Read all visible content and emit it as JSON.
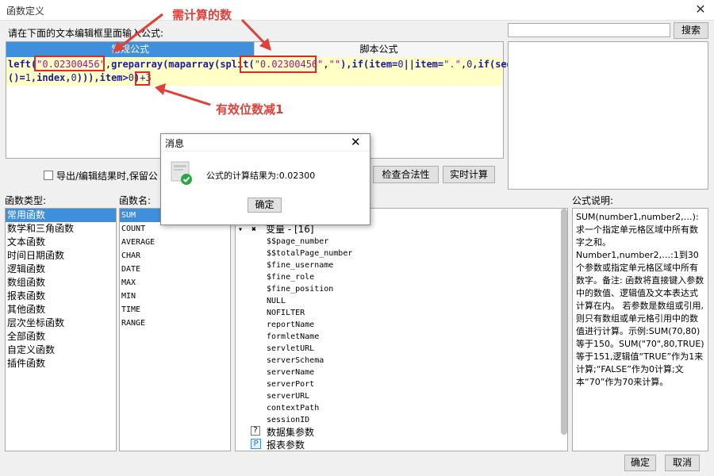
{
  "window": {
    "title": "函数定义"
  },
  "prompt": "请在下面的文本编辑框里面输入公式:",
  "search": {
    "placeholder": "",
    "button": "搜索"
  },
  "tabs": [
    {
      "label": "常规公式",
      "active": true
    },
    {
      "label": "脚本公式",
      "active": false
    }
  ],
  "code": {
    "line1": [
      {
        "t": "left(",
        "c": "kw"
      },
      {
        "t": "\"0.02300456\"",
        "c": "str"
      },
      {
        "t": ",",
        "c": ""
      },
      {
        "t": "greparray(maparray(split(",
        "c": "kw"
      },
      {
        "t": "\"0.02300456\"",
        "c": "str"
      },
      {
        "t": ",",
        "c": ""
      },
      {
        "t": "\"\"",
        "c": "str"
      },
      {
        "t": "),if(item=",
        "c": "kw"
      },
      {
        "t": "0",
        "c": "num"
      },
      {
        "t": "||item=",
        "c": "kw"
      },
      {
        "t": "\".\"",
        "c": "str"
      },
      {
        "t": ",",
        "c": ""
      },
      {
        "t": "0",
        "c": "num"
      },
      {
        "t": ",if(seq",
        "c": "kw"
      }
    ],
    "line2": [
      {
        "t": "()=",
        "c": "kw"
      },
      {
        "t": "1",
        "c": "num"
      },
      {
        "t": ",index,",
        "c": "kw"
      },
      {
        "t": "0",
        "c": "num"
      },
      {
        "t": "))),item>",
        "c": "kw"
      },
      {
        "t": "0",
        "c": "num"
      },
      {
        "t": ")",
        "c": "kw"
      },
      {
        "t": "+3",
        "c": "num"
      }
    ]
  },
  "options": {
    "checkbox_label": "导出/编辑结果时,保留公",
    "check_button": "检查合法性",
    "realtime_button": "实时计算"
  },
  "labels": {
    "func_type": "函数类型:",
    "func_name": "函数名:",
    "desc": "公式说明:"
  },
  "func_types": [
    "常用函数",
    "数学和三角函数",
    "文本函数",
    "时间日期函数",
    "逻辑函数",
    "数组函数",
    "报表函数",
    "其他函数",
    "层次坐标函数",
    "全部函数",
    "自定义函数",
    "插件函数"
  ],
  "func_names": [
    "SUM",
    "COUNT",
    "AVERAGE",
    "CHAR",
    "DATE",
    "MAX",
    "MIN",
    "TIME",
    "RANGE"
  ],
  "tree": {
    "variables_label": "变量 - [16]",
    "variables": [
      "$$page_number",
      "$$totalPage_number",
      "$fine_username",
      "$fine_role",
      "$fine_position",
      "NULL",
      "NOFILTER",
      "reportName",
      "formletName",
      "servletURL",
      "serverSchema",
      "serverName",
      "serverPort",
      "serverURL",
      "contextPath",
      "sessionID"
    ],
    "dataset_label": "数据集参数",
    "report_label": "报表参数"
  },
  "description": "SUM(number1,number2,…): 求一个指定单元格区域中所有数字之和。Number1,number2,…:1到30个参数或指定单元格区域中所有数字。备注: 函数将直接键入参数中的数值、逻辑值及文本表达式计算在内。 若参数是数组或引用,则只有数组或单元格引用中的数值进行计算。示例:SUM(70,80)等于150。SUM(\"70\",80,TRUE)等于151,逻辑值“TRUE”作为1来计算;“FALSE”作为0计算;文本“70”作为70来计算。",
  "footer": {
    "ok": "确定",
    "cancel": "取消"
  },
  "dialog": {
    "title": "消息",
    "message": "公式的计算结果为:0.02300",
    "ok": "确定"
  },
  "annotations": {
    "top": "需计算的数",
    "bottom": "有效位数减1"
  },
  "colors": {
    "accent": "#3f8fdc",
    "annotation": "#e0403a",
    "code_bg": "#ffffc6"
  }
}
